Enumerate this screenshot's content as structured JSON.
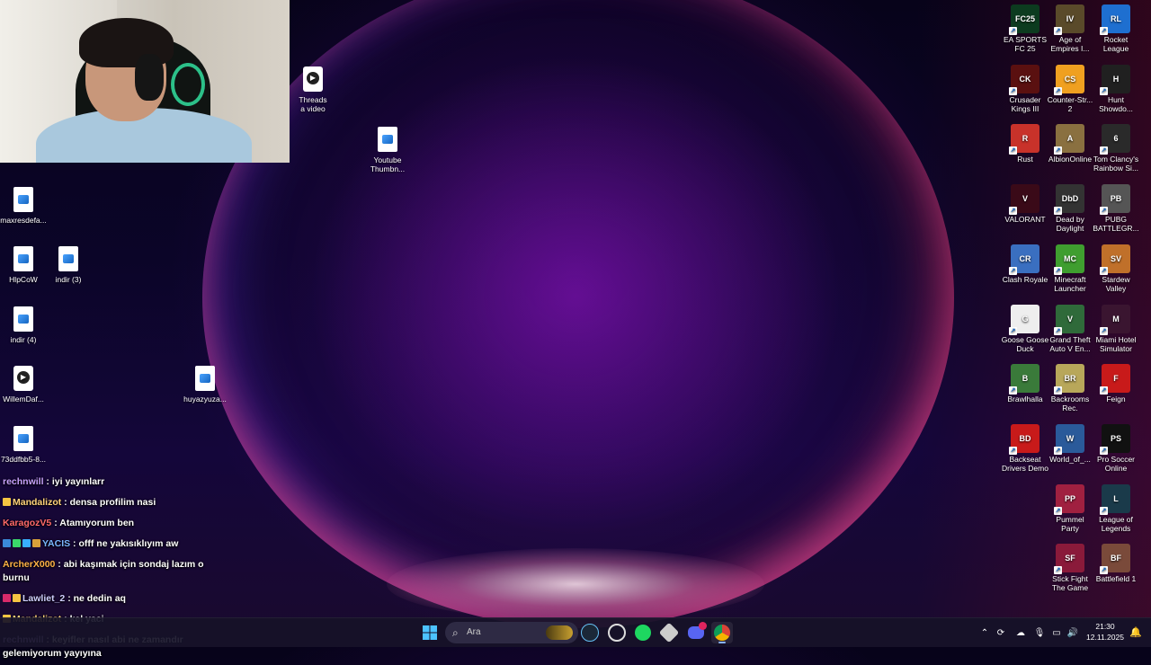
{
  "desktop_left_icons": [
    {
      "label": "maxresdefa...",
      "kind": "image"
    },
    {
      "label": "HlpCoW",
      "kind": "image"
    },
    {
      "label": "indir (3)",
      "kind": "image"
    },
    {
      "label": "indir (4)",
      "kind": "image"
    },
    {
      "label": "WillemDaf...",
      "kind": "video"
    },
    {
      "label": "huyazyuza...",
      "kind": "image"
    },
    {
      "label": "73ddfbb5-8...",
      "kind": "image"
    },
    {
      "label": "Youtube\nThumbn...",
      "kind": "image"
    },
    {
      "label": "Threads\na video",
      "kind": "video"
    }
  ],
  "desktop_right_icons": [
    {
      "label": "EA SPORTS\nFC 25",
      "color": "#0c3b1f",
      "glyph": "FC25"
    },
    {
      "label": "Age of\nEmpires I...",
      "color": "#5a4a2a",
      "glyph": "IV"
    },
    {
      "label": "Rocket\nLeague",
      "color": "#1e6fd0",
      "glyph": "RL"
    },
    {
      "label": "Crusader\nKings III",
      "color": "#5a1010",
      "glyph": "CK"
    },
    {
      "label": "Counter-Str...\n2",
      "color": "#f0a020",
      "glyph": "CS"
    },
    {
      "label": "Hunt\nShowdo...",
      "color": "#202020",
      "glyph": "H"
    },
    {
      "label": "Rust",
      "color": "#c8322a",
      "glyph": "R"
    },
    {
      "label": "AlbionOnline",
      "color": "#8a7040",
      "glyph": "A"
    },
    {
      "label": "Tom Clancy's\nRainbow Si...",
      "color": "#2a2a2a",
      "glyph": "6"
    },
    {
      "label": "VALORANT",
      "color": "#3a0a18",
      "glyph": "V"
    },
    {
      "label": "Dead by\nDaylight",
      "color": "#333",
      "glyph": "DbD"
    },
    {
      "label": "PUBG\nBATTLEGR...",
      "color": "#555",
      "glyph": "PB"
    },
    {
      "label": "Clash Royale",
      "color": "#3a6fc0",
      "glyph": "CR"
    },
    {
      "label": "Minecraft\nLauncher",
      "color": "#3f9e2f",
      "glyph": "MC"
    },
    {
      "label": "Stardew\nValley",
      "color": "#c0702a",
      "glyph": "SV"
    },
    {
      "label": "Goose Goose\nDuck",
      "color": "#eee",
      "glyph": "G"
    },
    {
      "label": "Grand Theft\nAuto V En...",
      "color": "#2f6a3a",
      "glyph": "V"
    },
    {
      "label": "Miami Hotel\nSimulator",
      "color": "#3a1530",
      "glyph": "M"
    },
    {
      "label": "Brawlhalla",
      "color": "#3a7a3a",
      "glyph": "B"
    },
    {
      "label": "Backrooms\nRec.",
      "color": "#b8a75a",
      "glyph": "BR"
    },
    {
      "label": "Feign",
      "color": "#c81a1a",
      "glyph": "F"
    },
    {
      "label": "Backseat\nDrivers Demo",
      "color": "#c81a1a",
      "glyph": "BD"
    },
    {
      "label": "World_of_...",
      "color": "#2a5a9a",
      "glyph": "W"
    },
    {
      "label": "Pro Soccer\nOnline",
      "color": "#111",
      "glyph": "PS"
    },
    {
      "label": "",
      "color": "transparent",
      "glyph": ""
    },
    {
      "label": "Pummel\nParty",
      "color": "#a02040",
      "glyph": "PP"
    },
    {
      "label": "League of\nLegends",
      "color": "#1a3a4a",
      "glyph": "L"
    },
    {
      "label": "",
      "color": "transparent",
      "glyph": ""
    },
    {
      "label": "Stick Fight\nThe Game",
      "color": "#8a1a3a",
      "glyph": "SF"
    },
    {
      "label": "Battlefield 1",
      "color": "#7a4a3a",
      "glyph": "BF"
    }
  ],
  "chat": [
    {
      "user": "rechnwill",
      "color": "#c9a3ff",
      "badges": [],
      "text": "iyi yayınlarr"
    },
    {
      "user": "Mandalizot",
      "color": "#ffd37a",
      "badges": [
        "#f5c542"
      ],
      "text": "densa profilim nasi"
    },
    {
      "user": "KaragozV5",
      "color": "#ff6a6a",
      "badges": [],
      "text": "Atamıyorum ben"
    },
    {
      "user": "YACIS",
      "color": "#7ab8ff",
      "badges": [
        "#3a8ad8",
        "#3ad86a",
        "#38b0ff",
        "#d8a03a"
      ],
      "text": "offf ne yakısıklıyım aw"
    },
    {
      "user": "ArcherX000",
      "color": "#ffb347",
      "badges": [],
      "text": "abi kaşımak için sondaj lazım o burnu"
    },
    {
      "user": "Lawliet_2",
      "color": "#d0d0ff",
      "badges": [
        "#d82a6a",
        "#f5c542"
      ],
      "text": "ne dedin aq"
    },
    {
      "user": "Mandalizot",
      "color": "#ffd37a",
      "badges": [
        "#f5c542"
      ],
      "text": "kel yaci"
    },
    {
      "user": "rechnwill",
      "color": "#c9a3ff",
      "badges": [],
      "text": "keyifler nasıl abi ne zamandır gelemiyorum yayıyına"
    }
  ],
  "taskbar": {
    "search_placeholder": "Ara",
    "time": "21:30",
    "date": "12.11.2025"
  }
}
